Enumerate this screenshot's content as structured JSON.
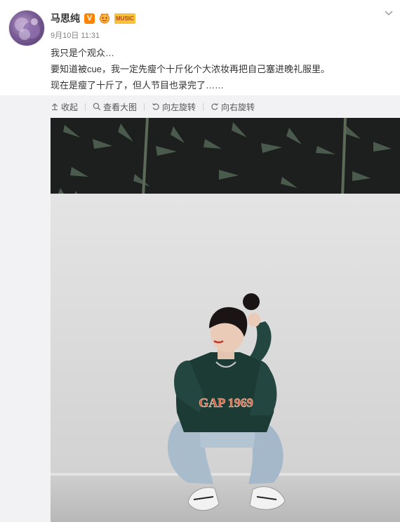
{
  "post": {
    "author": "马思纯",
    "timestamp": "9月10日 11:31",
    "badge_v": "V",
    "badge_music": "MUSIC",
    "lines": [
      "我只是个观众…",
      "要知道被cue，我一定先瘦个十斤化个大浓妆再把自己塞进晚礼服里。",
      "现在是瘦了十斤了，但人节目也录完了……"
    ]
  },
  "toolbar": {
    "collapse": "收起",
    "view_large": "查看大图",
    "rotate_left": "向左旋转",
    "rotate_right": "向右旋转"
  },
  "photo": {
    "shirt_text": "GAP 1969"
  },
  "icons": {
    "dropdown": "chevron-down-icon",
    "collapse": "arrow-up-icon",
    "view_large": "magnifier-icon",
    "rotate_left": "rotate-left-icon",
    "rotate_right": "rotate-right-icon"
  },
  "colors": {
    "badge_v": "#ff8200",
    "text": "#333333",
    "meta": "#808080",
    "toolbar_bg": "#f2f2f5"
  }
}
